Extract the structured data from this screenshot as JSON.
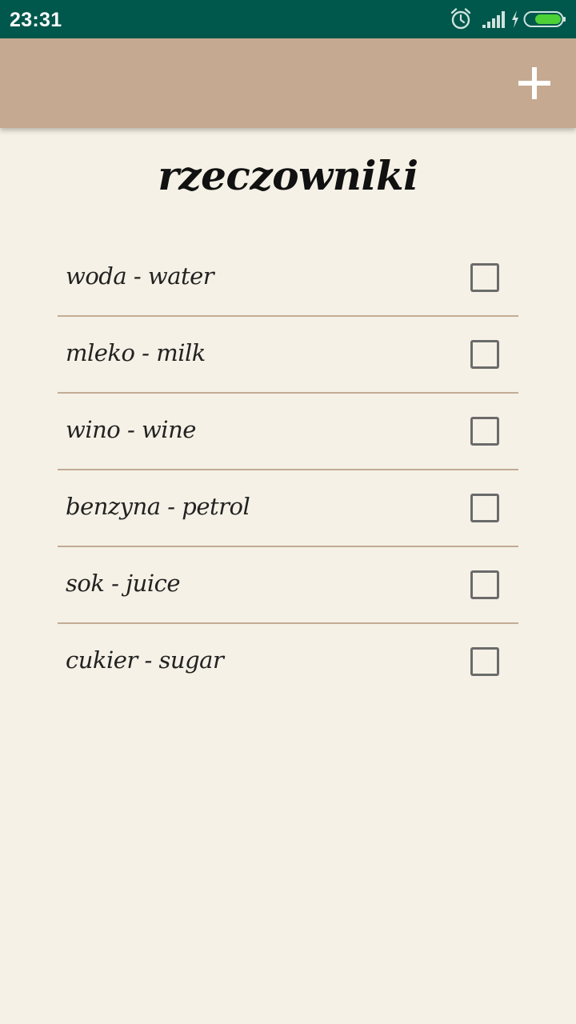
{
  "status_bar": {
    "time": "23:31",
    "icons": [
      "alarm-icon",
      "signal-icon",
      "charging-icon",
      "battery-icon"
    ],
    "battery_color": "#4cd137"
  },
  "app_bar": {
    "background": "#c5a991",
    "add_icon": "plus-icon"
  },
  "page": {
    "title": "rzeczowniki"
  },
  "words": [
    {
      "label": "woda - water",
      "checked": false
    },
    {
      "label": "mleko - milk",
      "checked": false
    },
    {
      "label": "wino - wine",
      "checked": false
    },
    {
      "label": "benzyna - petrol",
      "checked": false
    },
    {
      "label": "sok - juice",
      "checked": false
    },
    {
      "label": "cukier - sugar",
      "checked": false
    }
  ]
}
